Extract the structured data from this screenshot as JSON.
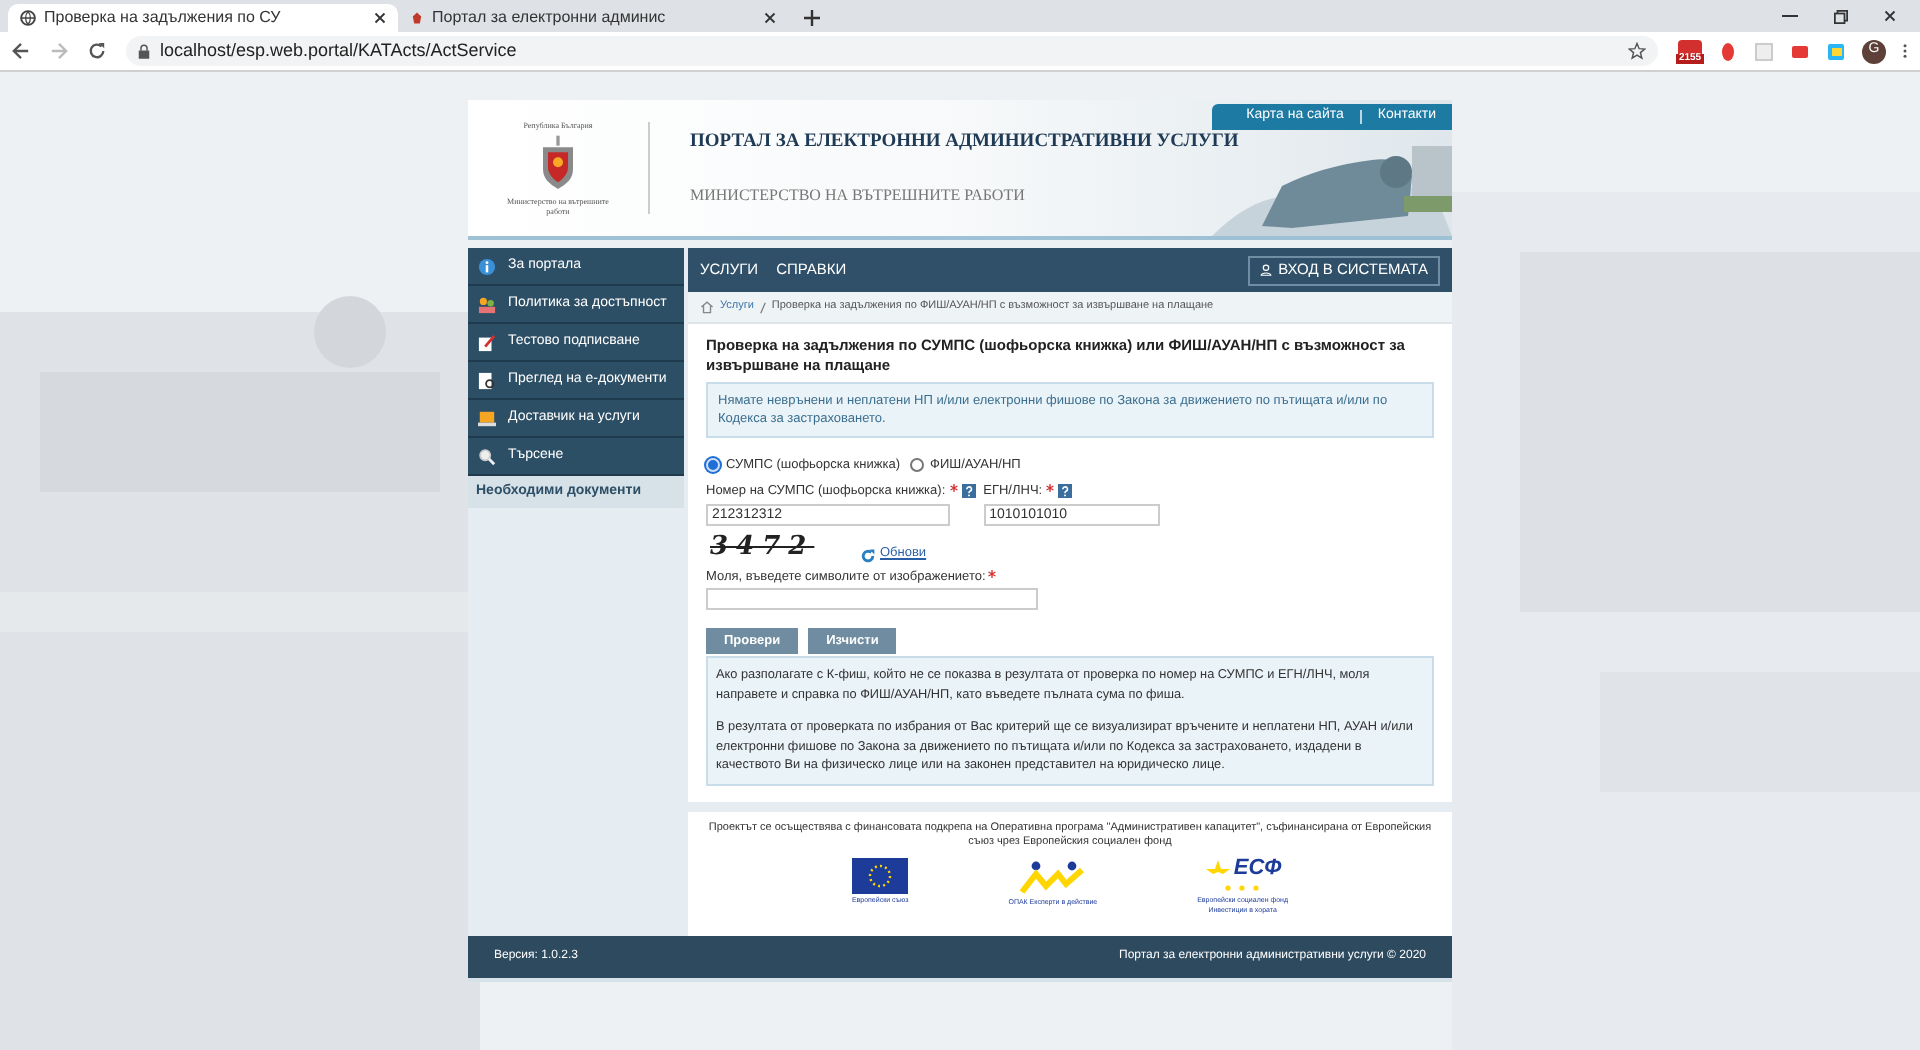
{
  "browser": {
    "tabs": [
      {
        "title": "Проверка на задължения по СУ",
        "selected": true
      },
      {
        "title": "Портал за електронни админис",
        "selected": false
      }
    ],
    "url": "localhost/esp.web.portal/KATActs/ActService",
    "extension_badge": "2155",
    "avatar": "G"
  },
  "header": {
    "emblem_top": "Република България",
    "emblem_bottom": "Министерство на вътрешните работи",
    "title": "ПОРТАЛ ЗА ЕЛЕКТРОННИ АДМИНИСТРАТИВНИ УСЛУГИ",
    "subtitle": "МИНИСТЕРСТВО НА ВЪТРЕШНИТЕ РАБОТИ",
    "links": [
      "Карта на сайта",
      "Контакти"
    ]
  },
  "sidebar": {
    "items": [
      {
        "label": "За портала",
        "kind": "link"
      },
      {
        "label": "Политика за достъпност",
        "kind": "link"
      },
      {
        "label": "Тестово подписване",
        "kind": "link"
      },
      {
        "label": "Преглед на е-документи",
        "kind": "link"
      },
      {
        "label": "Доставчик на услуги",
        "kind": "link"
      },
      {
        "label": "Търсене",
        "kind": "link"
      },
      {
        "label": "Необходими документи",
        "kind": "section"
      }
    ]
  },
  "nav": {
    "items": [
      "УСЛУГИ",
      "СПРАВКИ"
    ],
    "login": "ВХОД В СИСТЕМАТА"
  },
  "breadcrumb": [
    "Услуги",
    "Проверка на задължения по ФИШ/АУАН/НП с възможност за извършване на плащане"
  ],
  "page_title": "Проверка на задължения по СУМПС (шофьорска книжка) или ФИШ/АУАН/НП с възможност за извършване на плащане",
  "notice": "Нямате неврънени и неплатени НП и/или електронни фишове по Закона за движението по пътищата и/или по Кодекса за застраховането.",
  "search_type": [
    {
      "label": "СУМПС (шофьорска книжка)",
      "selected": true
    },
    {
      "label": "ФИШ/АУАН/НП",
      "selected": false
    }
  ],
  "fields": [
    {
      "label": "Номер на СУМПС (шофьорска книжка):",
      "value": "212312312"
    },
    {
      "label": "ЕГН/ЛНЧ:",
      "value": "1010101010"
    }
  ],
  "captcha": {
    "text": "3472",
    "refresh": "Обнови",
    "label": "Моля, въведете символите от изображението:"
  },
  "buttons": [
    "Провери",
    "Изчисти"
  ],
  "info": [
    "Ако разполагате с К-фиш, който не се показва в резултата от проверка по номер на СУМПС и ЕГН/ЛНЧ, моля направете и справка по ФИШ/АУАН/НП, като въведете пълната сума по фиша.",
    "В резултата от проверката по избрания от Вас критерий ще се визуализират връчените и неплатени НП, АУАН и/или електронни фишове по Закона за движението по пътищата и/или по Кодекса за застраховането, издадени в качеството Ви на физическо лице или на законен представител на юридическо лице."
  ],
  "funding": {
    "text": "Проектът се осъществява с финансовата подкрепа на Оперативна програма \"Административен капацитет\", съфинансирана от Европейския съюз чрез Европейския социален фонд",
    "logos": [
      {
        "kind": "eu",
        "captions": [
          "Европейски съюз"
        ]
      },
      {
        "kind": "opac",
        "captions": [
          "ОПАК Експерти в действие"
        ]
      },
      {
        "kind": "esf",
        "captions": [
          "ЕСФ",
          "Европейски социален фонд",
          "Инвестиции в хората"
        ]
      }
    ]
  },
  "footer": {
    "version": "Версия: 1.0.2.3",
    "copyright": "Портал за електронни административни услуги © 2020"
  }
}
